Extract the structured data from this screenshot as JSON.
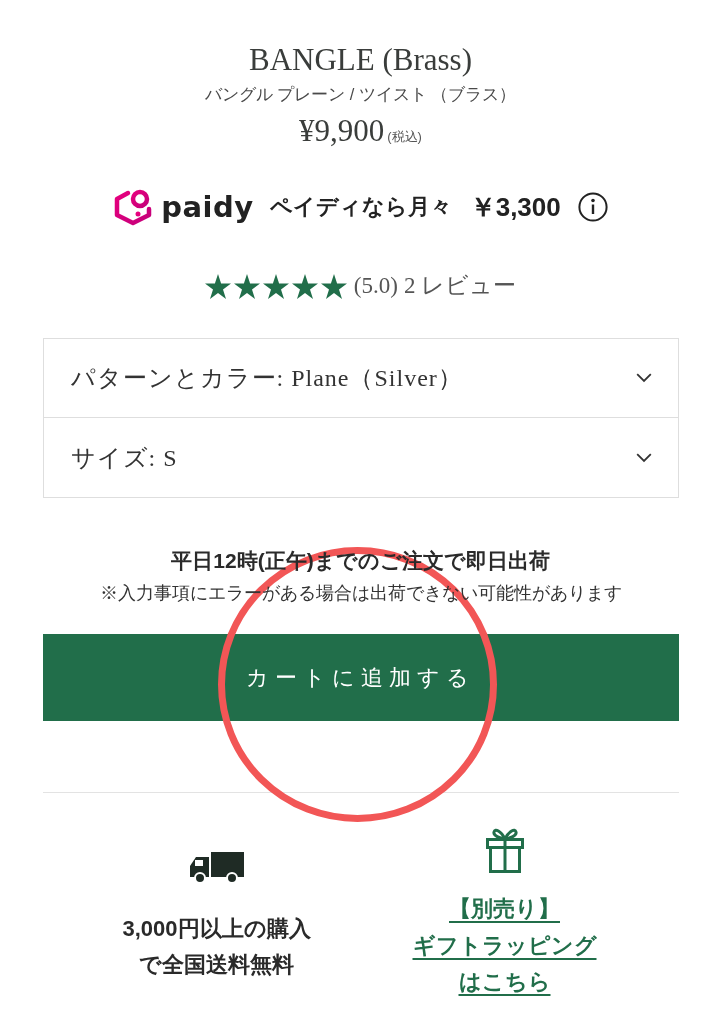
{
  "product": {
    "title": "BANGLE (Brass)",
    "subtitle": "バングル プレーン / ツイスト （ブラス）",
    "price": "¥9,900",
    "tax_note": "(税込)"
  },
  "installment": {
    "brand": "paidy",
    "label": "ペイディなら月々",
    "amount": "￥3,300"
  },
  "rating": {
    "stars": 5,
    "score": "(5.0)",
    "reviews": "2 レビュー"
  },
  "options": [
    {
      "text": "パターンとカラー: Plane（Silver）"
    },
    {
      "text": "サイズ: S"
    }
  ],
  "shipping_notice": {
    "headline": "平日12時(正午)までのご注文で即日出荷",
    "note": "※入力事項にエラーがある場合は出荷できない可能性があります"
  },
  "add_to_cart": "カートに追加する",
  "features": [
    {
      "kind": "shipping",
      "lines": [
        "3,000円以上の購入",
        "で全国送料無料"
      ]
    },
    {
      "kind": "gift",
      "lines": [
        "【別売り】",
        "ギフトラッピング",
        "はこちら"
      ]
    }
  ],
  "annotations": [
    {
      "kind": "circle"
    }
  ]
}
